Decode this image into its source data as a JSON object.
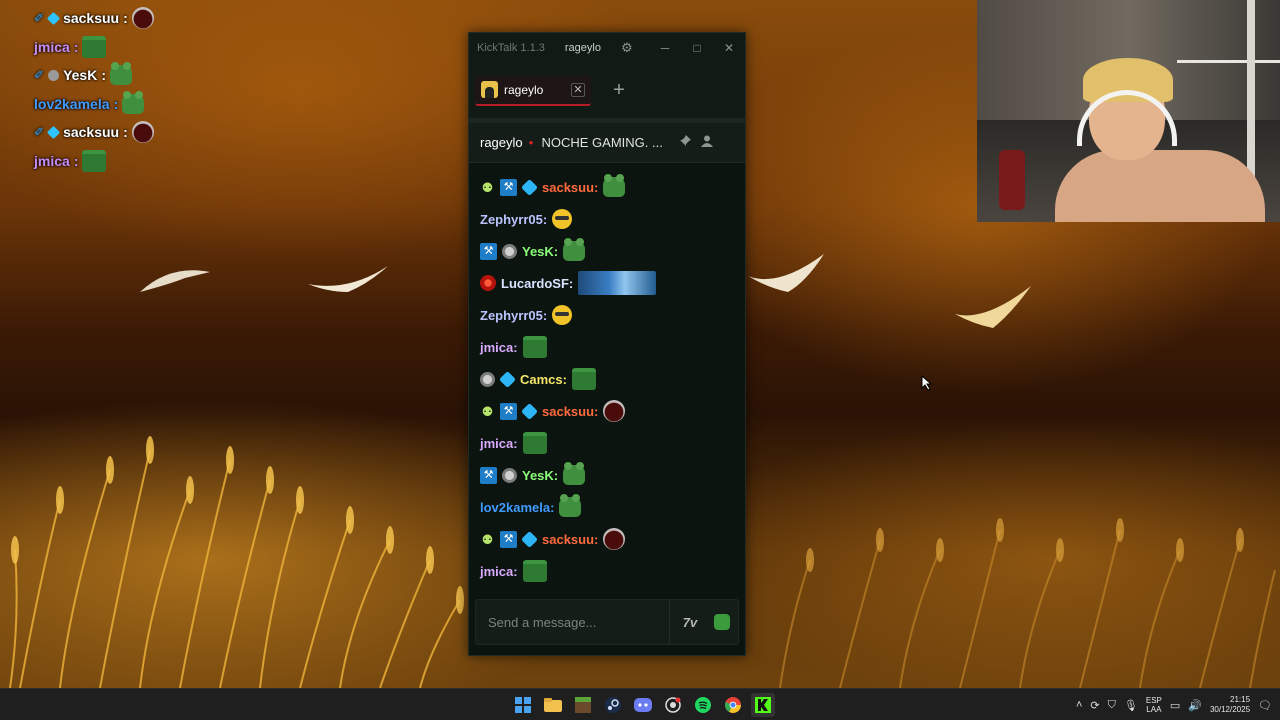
{
  "overlay_chat": [
    {
      "badges": [
        "pencil",
        "cube"
      ],
      "user": "sacksuu",
      "color": "#ffffff",
      "emote": "circle"
    },
    {
      "badges": [],
      "user": "jmica",
      "color": "#c98cf5",
      "emote": "block"
    },
    {
      "badges": [
        "pencil",
        "gray"
      ],
      "user": "YesK",
      "color": "#ffffff",
      "emote": "frog"
    },
    {
      "badges": [],
      "user": "lov2kamela",
      "color": "#3f9bff",
      "emote": "frog"
    },
    {
      "badges": [
        "pencil",
        "cube"
      ],
      "user": "sacksuu",
      "color": "#ffffff",
      "emote": "circle"
    },
    {
      "badges": [],
      "user": "jmica",
      "color": "#c98cf5",
      "emote": "block"
    }
  ],
  "window": {
    "app_title": "KickTalk 1.1.3",
    "channel_title": "rageylo",
    "minimize": "─",
    "maximize": "□",
    "close": "✕",
    "gear": "⚙",
    "tab_label": "rageylo",
    "tab_close": "✕",
    "add_tab": "+",
    "channel_name": "rageylo",
    "stream_title": "NOCHE GAMING. ...",
    "live_dot": "●",
    "input_placeholder": "Send a message...",
    "btn_7tv": "7v"
  },
  "messages": [
    {
      "badges": [
        "bot",
        "hammer",
        "cube"
      ],
      "user": "sacksuu:",
      "color": "#ff6b3d",
      "emote": "frog"
    },
    {
      "badges": [],
      "user": "Zephyrr05:",
      "color": "#b9c4ff",
      "emote": "pepe"
    },
    {
      "badges": [
        "hammer",
        "gray"
      ],
      "user": "YesK:",
      "color": "#8cff7a",
      "emote": "frog"
    },
    {
      "badges": [
        "red"
      ],
      "user": "LucardoSF:",
      "color": "#d8e4ff",
      "emote": "cars"
    },
    {
      "badges": [],
      "user": "Zephyrr05:",
      "color": "#b9c4ff",
      "emote": "pepe"
    },
    {
      "badges": [],
      "user": "jmica:",
      "color": "#d9a9ff",
      "emote": "block"
    },
    {
      "badges": [
        "gray",
        "cube"
      ],
      "user": "Camcs:",
      "color": "#f5e66a",
      "emote": "block"
    },
    {
      "badges": [
        "bot",
        "hammer",
        "cube"
      ],
      "user": "sacksuu:",
      "color": "#ff6b3d",
      "emote": "circle"
    },
    {
      "badges": [],
      "user": "jmica:",
      "color": "#d9a9ff",
      "emote": "block"
    },
    {
      "badges": [
        "hammer",
        "gray"
      ],
      "user": "YesK:",
      "color": "#8cff7a",
      "emote": "frog"
    },
    {
      "badges": [],
      "user": "lov2kamela:",
      "color": "#3f9bff",
      "emote": "frog"
    },
    {
      "badges": [
        "bot",
        "hammer",
        "cube"
      ],
      "user": "sacksuu:",
      "color": "#ff6b3d",
      "emote": "circle"
    },
    {
      "badges": [],
      "user": "jmica:",
      "color": "#d9a9ff",
      "emote": "block"
    }
  ],
  "taskbar": {
    "apps": [
      "windows-start-icon",
      "file-explorer-icon",
      "minecraft-icon",
      "steam-icon",
      "discord-icon",
      "obs-icon",
      "spotify-icon",
      "chrome-icon",
      "kick-icon"
    ],
    "lang_top": "ESP",
    "lang_bottom": "LAA",
    "time": "21:15",
    "date": "30/12/2025"
  }
}
